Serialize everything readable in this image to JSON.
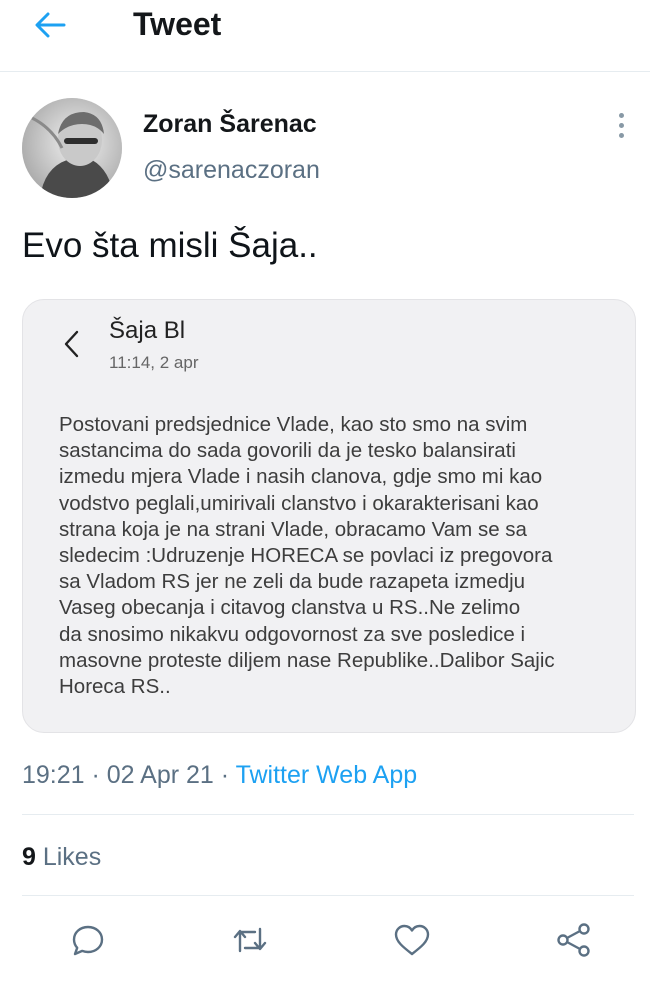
{
  "header": {
    "title": "Tweet",
    "back_icon": "arrow-left-icon"
  },
  "author": {
    "name": "Zoran Šarenac",
    "handle": "@sarenaczoran"
  },
  "tweet": {
    "text": "Evo šta misli Šaja.."
  },
  "quoted_message": {
    "contact": "Šaja Bl",
    "time": "11:14, 2 apr",
    "body": "Postovani predsjednice Vlade, kao sto smo na svim\nsastancima do sada govorili da je tesko balansirati\nizmedu mjera Vlade i nasih clanova, gdje smo mi kao\nvodstvo peglali,umirivali clanstvo i okarakterisani kao\nstrana koja je na strani Vlade, obracamo Vam se sa\nsledecim :Udruzenje HORECA se povlaci iz pregovora\nsa Vladom RS jer ne zeli da bude razapeta izmedju\nVaseg obecanja i citavog clanstva u RS..Ne zelimo\nda snosimo nikakvu odgovornost za sve posledice i\nmasovne proteste diljem nase Republike..Dalibor Sajic\nHoreca RS.."
  },
  "meta": {
    "time": "19:21",
    "separator1": " · ",
    "date": "02 Apr 21",
    "separator2": " · ",
    "app": "Twitter Web App"
  },
  "stats": {
    "likes_count": "9",
    "likes_label": " Likes"
  },
  "actions": [
    "reply-icon",
    "retweet-icon",
    "like-icon",
    "share-icon"
  ],
  "colors": {
    "accent": "#1da1f2",
    "muted": "#5b7083",
    "card_bg": "#f1f1f3"
  }
}
